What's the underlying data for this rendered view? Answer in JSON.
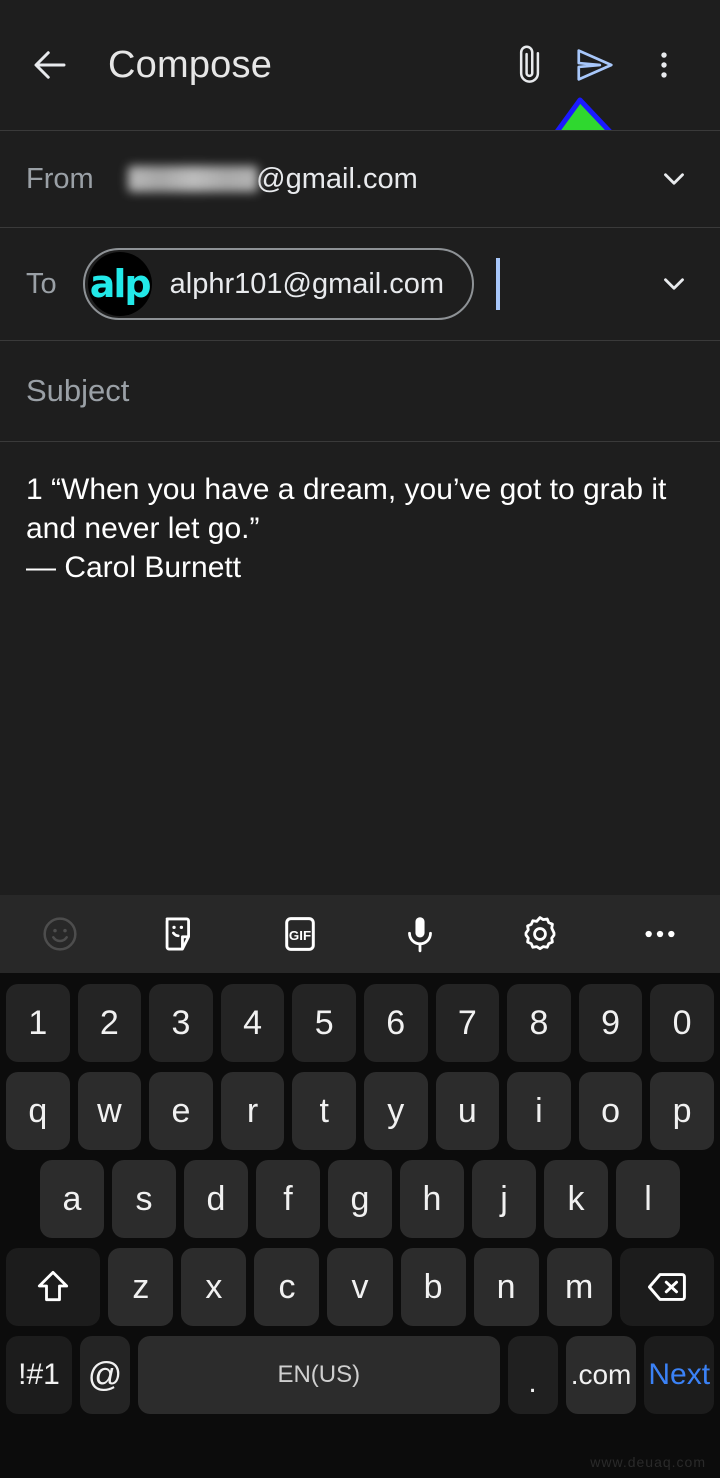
{
  "appbar": {
    "back_icon": "arrow-left-icon",
    "title": "Compose",
    "attach_icon": "paperclip-icon",
    "send_icon": "send-icon",
    "overflow_icon": "more-vert-icon"
  },
  "annotation": {
    "arrow_icon": "green-up-arrow-annotation",
    "fill_color": "#2fd82f",
    "stroke_color": "#1a1aff"
  },
  "fields": {
    "from": {
      "label": "From",
      "redacted_user": "xxxxxxxxx",
      "domain": "@gmail.com",
      "expand_icon": "chevron-down-icon"
    },
    "to": {
      "label": "To",
      "chip": {
        "avatar_text": "alp",
        "avatar_color": "#22e8e8",
        "email": "alphr101@gmail.com"
      },
      "expand_icon": "chevron-down-icon"
    },
    "subject": {
      "placeholder": "Subject"
    }
  },
  "body": {
    "text": "1 “When you have a dream, you’ve got to grab it and never let go.”\n— Carol Burnett"
  },
  "keyboard": {
    "toolbar": [
      {
        "name": "emoji-icon",
        "label": "emoji"
      },
      {
        "name": "sticker-icon",
        "label": "sticker"
      },
      {
        "name": "gif-icon",
        "label": "GIF"
      },
      {
        "name": "microphone-icon",
        "label": "voice"
      },
      {
        "name": "gear-icon",
        "label": "settings"
      },
      {
        "name": "more-horizontal-icon",
        "label": "more"
      }
    ],
    "row_numbers": [
      "1",
      "2",
      "3",
      "4",
      "5",
      "6",
      "7",
      "8",
      "9",
      "0"
    ],
    "row_top": [
      "q",
      "w",
      "e",
      "r",
      "t",
      "y",
      "u",
      "i",
      "o",
      "p"
    ],
    "row_home": [
      "a",
      "s",
      "d",
      "f",
      "g",
      "h",
      "j",
      "k",
      "l"
    ],
    "row_bottom": [
      "z",
      "x",
      "c",
      "v",
      "b",
      "n",
      "m"
    ],
    "shift_icon": "shift-icon",
    "backspace_icon": "backspace-icon",
    "symbols_key": "!#1",
    "at_key": "@",
    "space_key": "EN(US)",
    "period_key": ".",
    "dotcom_key": ".com",
    "next_key": "Next",
    "next_key_color": "#3b82f6"
  },
  "watermark": "www.deuaq.com"
}
